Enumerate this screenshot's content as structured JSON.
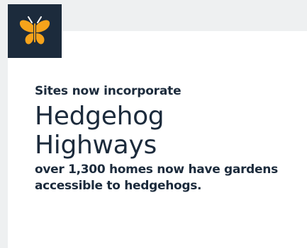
{
  "logo": {
    "icon": "butterfly-icon",
    "background_color": "#1c2b3c",
    "icon_color": "#f6a31b"
  },
  "stat_card": {
    "kicker": "Sites now incorporate",
    "headline_line1": "Hedgehog",
    "headline_line2": "Highways",
    "description_line1": "over 1,300 homes now have gardens",
    "description_line2": "accessible to hedgehogs.",
    "text_color": "#1c2b3c"
  }
}
